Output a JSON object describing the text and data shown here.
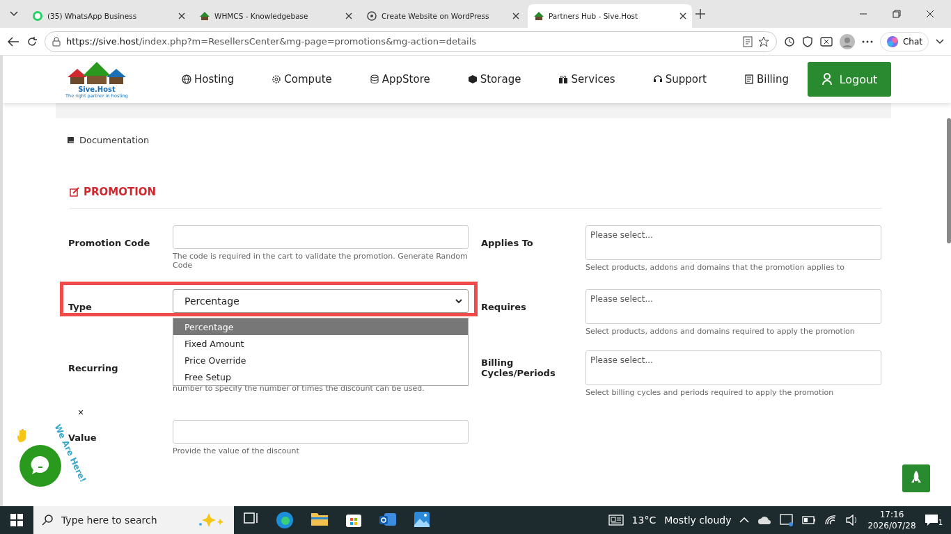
{
  "browser": {
    "tabs": [
      {
        "title": "(35) WhatsApp Business",
        "selected": false
      },
      {
        "title": "WHMCS - Knowledgebase",
        "selected": false
      },
      {
        "title": "Create Website on WordPress",
        "selected": false
      },
      {
        "title": "Partners Hub - Sive.Host",
        "selected": true
      }
    ],
    "url_host": "https://sive.host",
    "url_path": "/index.php?m=ResellersCenter&mg-page=promotions&mg-action=details",
    "chat": "Chat"
  },
  "header": {
    "logo_name": "Sive.Host",
    "logo_tagline": "The right partner in hosting",
    "nav": [
      {
        "label": "Hosting"
      },
      {
        "label": "Compute"
      },
      {
        "label": "AppStore"
      },
      {
        "label": "Storage"
      },
      {
        "label": "Services"
      },
      {
        "label": "Support"
      },
      {
        "label": "Billing"
      }
    ],
    "logout": "Logout"
  },
  "documentation": "Documentation",
  "section_title": "PROMOTION",
  "fields_left": [
    {
      "label": "Promotion Code",
      "kind": "input",
      "help": "The code is required in the cart to validate the promotion. Generate Random Code"
    },
    {
      "label": "Type",
      "kind": "select",
      "value": "Percentage",
      "highlighted": true
    },
    {
      "label": "Recurring",
      "kind": "hidden",
      "help": "number to specify the number of times the discount can be used."
    },
    {
      "label": "Value",
      "kind": "input",
      "help": "Provide the value of the discount"
    }
  ],
  "fields_right": [
    {
      "label": "Applies To",
      "placeholder": "Please select...",
      "help": "Select products, addons and domains that the promotion applies to"
    },
    {
      "label": "Requires",
      "placeholder": "Please select...",
      "help": "Select products, addons and domains required to apply the promotion"
    },
    {
      "label": "Billing Cycles/Periods",
      "placeholder": "Please select...",
      "help": "Select billing cycles and periods required to apply the promotion"
    }
  ],
  "dropdown": {
    "options": [
      {
        "label": "Percentage",
        "selected": true
      },
      {
        "label": "Fixed Amount",
        "selected": false
      },
      {
        "label": "Price Override",
        "selected": false
      },
      {
        "label": "Free Setup",
        "selected": false
      }
    ]
  },
  "chat_widget": {
    "text": "We Are Here!",
    "close": "×"
  },
  "taskbar": {
    "search": "Type here to search",
    "weather": "13°C",
    "weather_text": "Mostly cloudy",
    "time": "17:16",
    "date": "2026/07/28",
    "notifications": "1"
  }
}
